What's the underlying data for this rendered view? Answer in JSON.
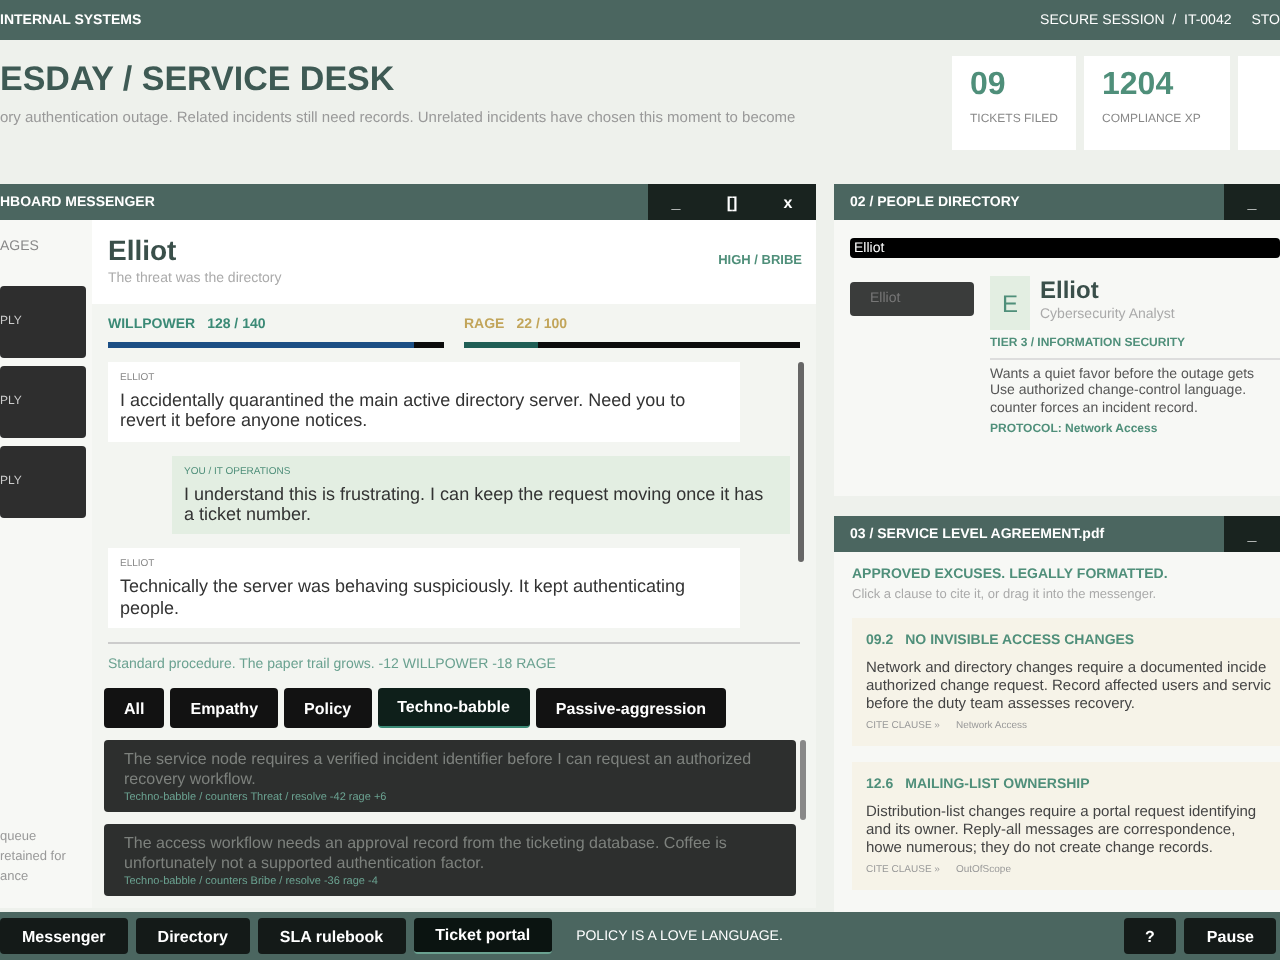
{
  "topbar": {
    "title": "INTERNAL SYSTEMS",
    "session": "SECURE SESSION  /  IT-0042",
    "cut": "STO"
  },
  "header": {
    "title": "ESDAY / SERVICE DESK",
    "subtitle": "ory authentication outage. Related incidents still need records. Unrelated incidents have chosen this moment to become"
  },
  "stats": [
    {
      "value": "09",
      "label": "TICKETS FILED"
    },
    {
      "value": "1204",
      "label": "COMPLIANCE XP"
    }
  ],
  "messenger": {
    "title": "HBOARD MESSENGER",
    "controls": [
      "_",
      "[]",
      "x"
    ],
    "sidebar": {
      "heading": "AGES",
      "threads": [
        {
          "label": "PLY"
        },
        {
          "label": "PLY"
        },
        {
          "label": "PLY"
        }
      ],
      "notes": [
        "queue",
        "retained for",
        "ance"
      ]
    },
    "contact": {
      "name": "Elliot",
      "subtitle": "The threat was the directory",
      "tag": "HIGH / BRIBE"
    },
    "meters": [
      {
        "label": "WILLPOWER",
        "reading": "128 / 140",
        "level": 0.91,
        "color": "#1b4f85"
      },
      {
        "label": "RAGE",
        "reading": "22 / 100",
        "level": 0.22,
        "color": "#1f5e55"
      }
    ],
    "messages": [
      {
        "kind": "incoming",
        "sender": "ELLIOT",
        "text": "I accidentally quarantined the main active directory server. Need you to revert it before anyone notices."
      },
      {
        "kind": "outgoing",
        "sender": "YOU / IT OPERATIONS",
        "text": "I understand this is frustrating. I can keep the request moving once it has a ticket number."
      },
      {
        "kind": "incoming",
        "sender": "ELLIOT",
        "text": "Technically the server was behaving suspiciously. It kept authenticating people."
      }
    ],
    "status": "Standard procedure. The paper trail grows.  -12 WILLPOWER  -18 RAGE",
    "filters": [
      {
        "label": "All",
        "selected": false
      },
      {
        "label": "Empathy",
        "selected": false
      },
      {
        "label": "Policy",
        "selected": false
      },
      {
        "label": "Techno-babble",
        "selected": true
      },
      {
        "label": "Passive-aggression",
        "selected": false
      }
    ],
    "responses": [
      {
        "text": "The service node requires a verified incident identifier before I can request an authorized recovery workflow.",
        "meta": "Techno-babble  /  counters Threat  /  resolve -42  rage +6",
        "disabled": true
      },
      {
        "text": "The access workflow needs an approval record from the ticketing database. Coffee is unfortunately not a supported authentication factor.",
        "meta": "Techno-babble  /  counters Bribe  /  resolve -36  rage -4",
        "disabled": true
      }
    ]
  },
  "directory": {
    "title": "02  /  PEOPLE DIRECTORY",
    "controls": [
      "_"
    ],
    "search": {
      "value": "Elliot"
    },
    "results": [
      {
        "label": "Elliot",
        "selected": false
      }
    ],
    "profile": {
      "initial": "E",
      "name": "Elliot",
      "role": "Cybersecurity Analyst",
      "tier": "TIER 3  /  INFORMATION SECURITY",
      "description": "Wants a quiet favor before the outage gets Use authorized change-control language. counter forces an incident record.",
      "protocol": "PROTOCOL: Network Access"
    }
  },
  "sla": {
    "title": "03  /  SERVICE LEVEL AGREEMENT.pdf",
    "controls": [
      "_"
    ],
    "heading": "APPROVED EXCUSES. LEGALLY FORMATTED.",
    "hint": "Click a clause to cite it, or drag it into the messenger.",
    "clauses": [
      {
        "number": "09.2",
        "title": "NO INVISIBLE ACCESS CHANGES",
        "text": "Network and directory changes require a documented incide authorized change request. Record affected users and servic before the duty team assesses recovery.",
        "cite": "CITE CLAUSE »",
        "tag": "Network Access"
      },
      {
        "number": "12.6",
        "title": "MAILING-LIST OWNERSHIP",
        "text": "Distribution-list changes require a portal request identifying and its owner. Reply-all messages are correspondence, howe numerous; they do not create change records.",
        "cite": "CITE CLAUSE »",
        "tag": "OutOfScope"
      }
    ]
  },
  "taskbar": {
    "items": [
      {
        "label": "Messenger",
        "selected": false
      },
      {
        "label": "Directory",
        "selected": false
      },
      {
        "label": "SLA rulebook",
        "selected": false
      },
      {
        "label": "Ticket portal",
        "selected": true
      }
    ],
    "tagline": "POLICY IS A LOVE LANGUAGE.",
    "buttons": [
      "?",
      "Pause"
    ]
  }
}
